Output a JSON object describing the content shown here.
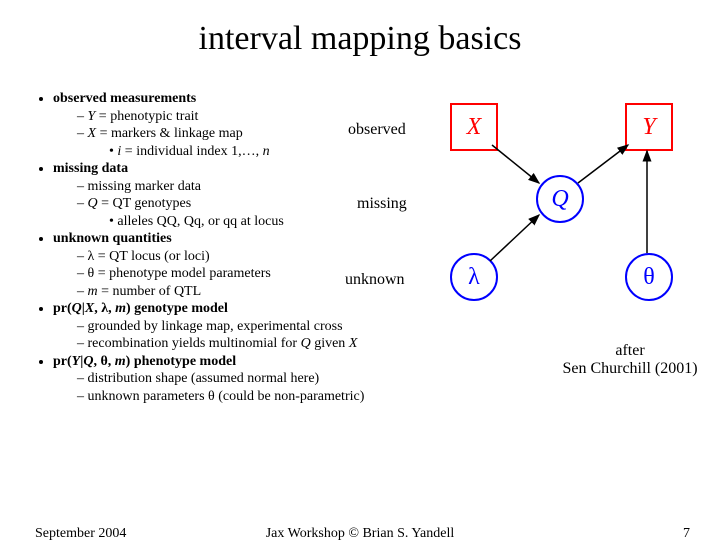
{
  "title": "interval mapping basics",
  "bullets": {
    "b1": "observed measurements",
    "b1_1": "Y = phenotypic trait",
    "b1_2": "X = markers & linkage map",
    "b1_2_1": "i  = individual index 1,…, n",
    "b2": "missing data",
    "b2_1": "missing marker data",
    "b2_2": "Q = QT genotypes",
    "b2_2_1": "alleles QQ, Qq, or qq at locus",
    "b3": "unknown quantities",
    "b3_1": "λ = QT locus (or loci)",
    "b3_2": "θ  = phenotype model parameters",
    "b3_3": "m = number of QTL",
    "b4": "pr(Q|X, λ, m) genotype model",
    "b4_1": "grounded by linkage map, experimental cross",
    "b4_2": "recombination yields multinomial for Q given X",
    "b5": "pr(Y|Q, θ, m) phenotype model",
    "b5_1": "distribution shape (assumed normal here)",
    "b5_2": "unknown parameters θ  (could be non-parametric)"
  },
  "diagram": {
    "observed": "observed",
    "missing": "missing",
    "unknown": "unknown",
    "X": "X",
    "Y": "Y",
    "Q": "Q",
    "lambda": "λ",
    "theta": "θ"
  },
  "caption_l1": "after",
  "caption_l2": "Sen Churchill (2001)",
  "footer_left": "September 2004",
  "footer_center": "Jax Workshop © Brian S. Yandell",
  "footer_right": "7"
}
